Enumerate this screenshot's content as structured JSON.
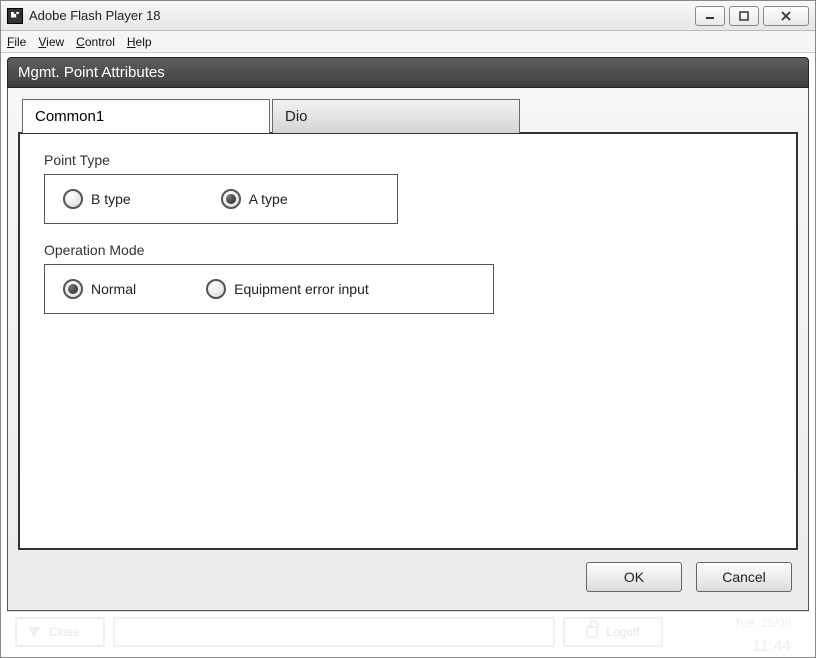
{
  "window": {
    "title": "Adobe Flash Player 18"
  },
  "menubar": {
    "file": "File",
    "view": "View",
    "control": "Control",
    "help": "Help"
  },
  "panel": {
    "title": "Mgmt. Point Attributes"
  },
  "tabs": [
    {
      "label": "Common1",
      "active": true
    },
    {
      "label": "Dio",
      "active": false
    }
  ],
  "point_type": {
    "label": "Point Type",
    "options": [
      {
        "label": "B type",
        "selected": false
      },
      {
        "label": "A type",
        "selected": true
      }
    ]
  },
  "operation_mode": {
    "label": "Operation Mode",
    "options": [
      {
        "label": "Normal",
        "selected": true
      },
      {
        "label": "Equipment error input",
        "selected": false
      }
    ]
  },
  "buttons": {
    "ok": "OK",
    "cancel": "Cancel"
  },
  "statusbar": {
    "close": "Close",
    "logoff": "Logoff",
    "date": "Tue, 25/08",
    "time": "11:44"
  }
}
